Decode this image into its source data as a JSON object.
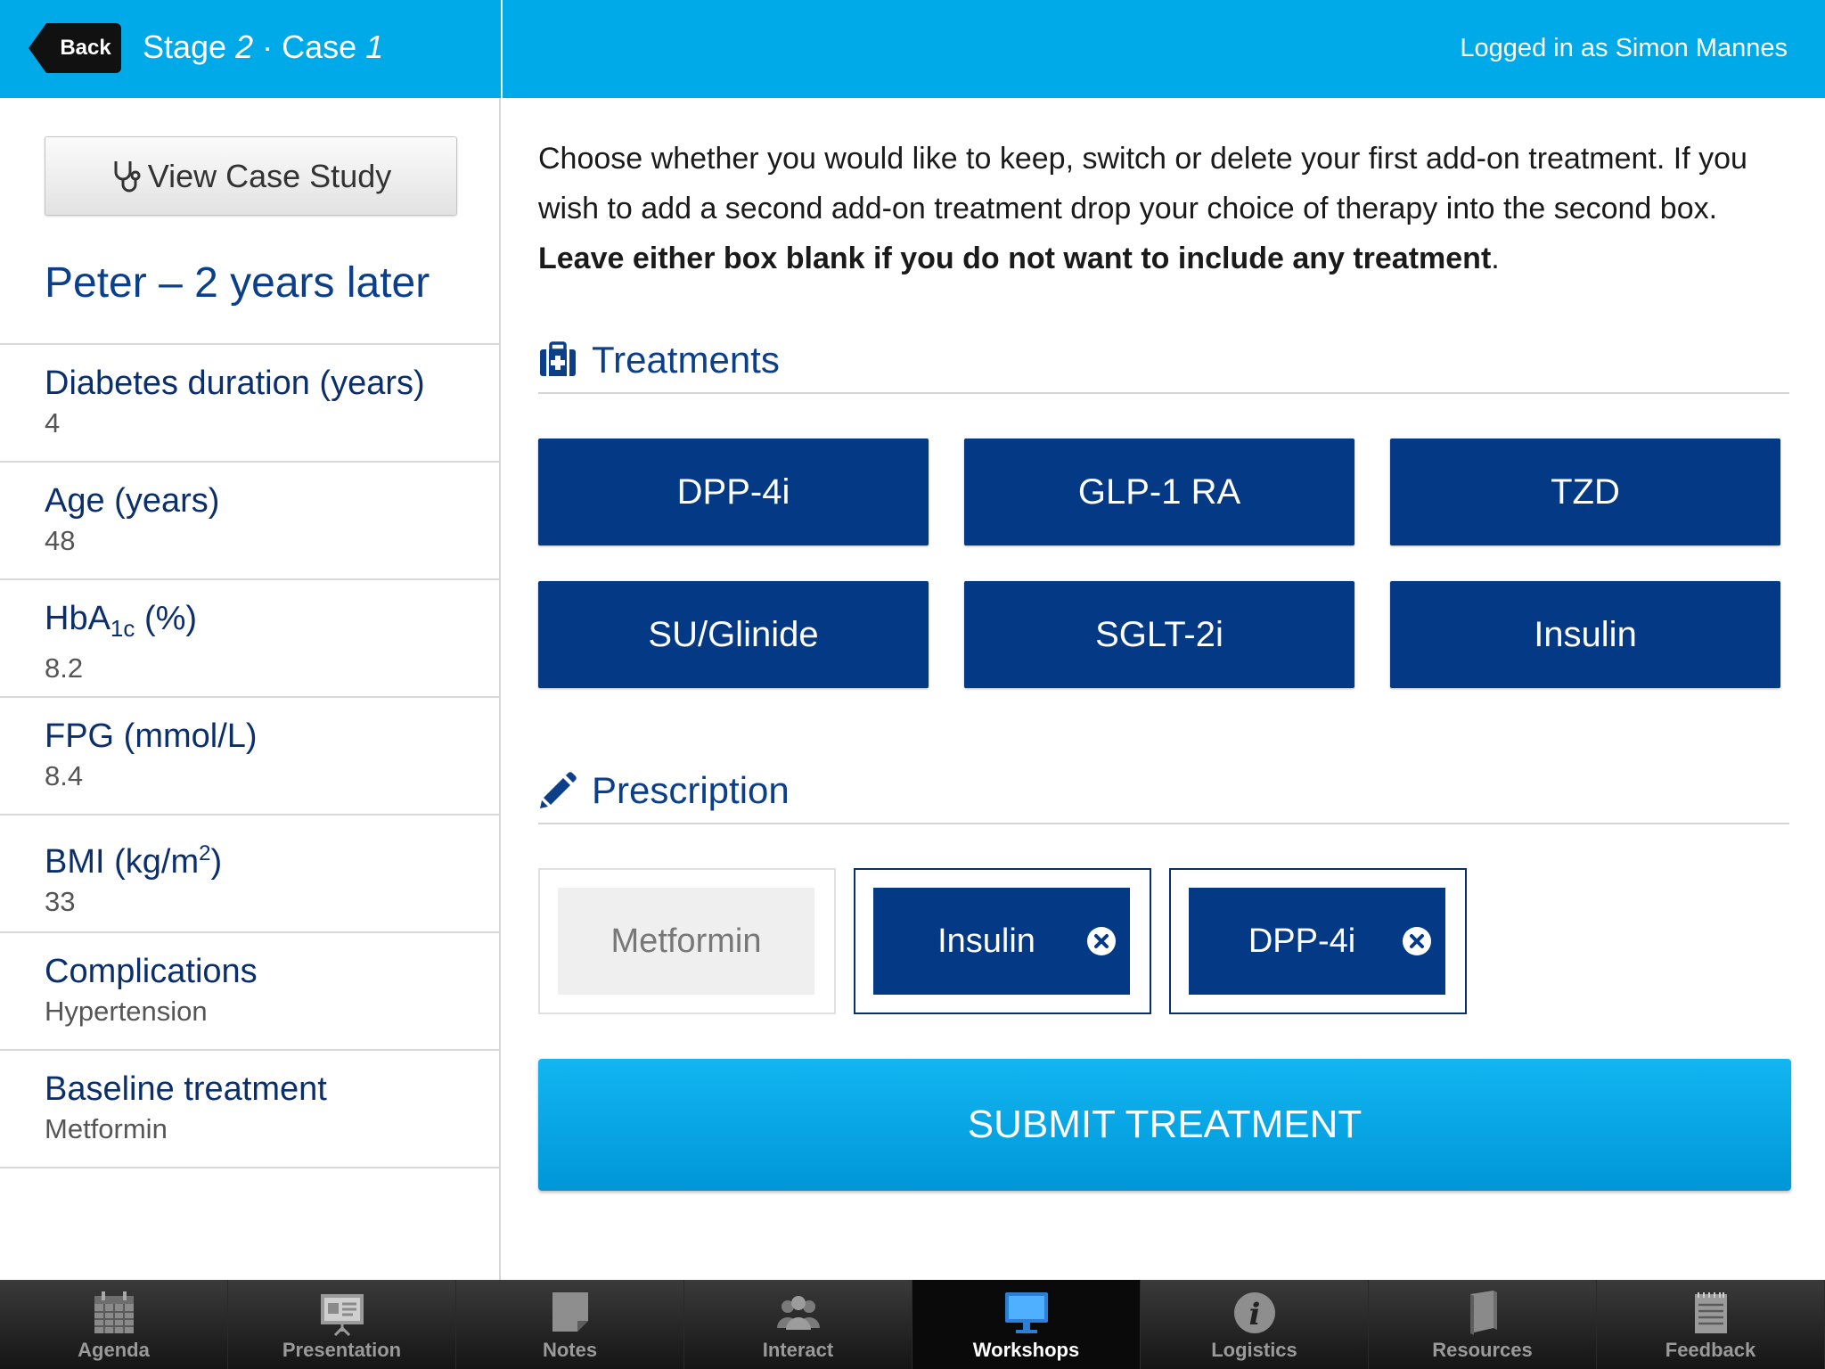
{
  "header": {
    "back_label": "Back",
    "stage_word": "Stage",
    "stage_number": "2",
    "separator": "·",
    "case_word": "Case",
    "case_number": "1",
    "logged_in": "Logged in as Simon Mannes"
  },
  "sidebar": {
    "view_case_label": "View Case Study",
    "patient_title": "Peter – 2 years later",
    "items": [
      {
        "label": "Diabetes duration (years)",
        "value": "4"
      },
      {
        "label_main": "Age (years)",
        "value": "48"
      },
      {
        "label_pre": "HbA",
        "label_sub": "1c",
        "label_post": " (%)",
        "value": "8.2"
      },
      {
        "label": "FPG (mmol/L)",
        "value": "8.4"
      },
      {
        "label_pre": "BMI (kg/m",
        "label_sup": "2",
        "label_post": ")",
        "value": "33"
      },
      {
        "label": "Complications",
        "value": "Hypertension"
      },
      {
        "label": "Baseline treatment",
        "value": "Metformin"
      }
    ]
  },
  "main": {
    "instructions_plain": "Choose whether you would like to keep, switch or delete your first add-on treatment. If you wish to add a second add-on treatment drop your choice of therapy into the second box. ",
    "instructions_bold": "Leave either box blank if you do not want to include any treatment",
    "instructions_end": ".",
    "treatments_heading": "Treatments",
    "treatments": [
      "DPP-4i",
      "GLP-1 RA",
      "TZD",
      "SU/Glinide",
      "SGLT-2i",
      "Insulin"
    ],
    "prescription_heading": "Prescription",
    "prescription": [
      {
        "label": "Metformin",
        "removable": false
      },
      {
        "label": "Insulin",
        "removable": true
      },
      {
        "label": "DPP-4i",
        "removable": true
      }
    ],
    "submit_label": "SUBMIT TREATMENT"
  },
  "tabbar": {
    "tabs": [
      {
        "label": "Agenda",
        "icon": "calendar-icon",
        "active": false
      },
      {
        "label": "Presentation",
        "icon": "presentation-icon",
        "active": false
      },
      {
        "label": "Notes",
        "icon": "notes-icon",
        "active": false
      },
      {
        "label": "Interact",
        "icon": "people-icon",
        "active": false
      },
      {
        "label": "Workshops",
        "icon": "monitor-icon",
        "active": true
      },
      {
        "label": "Logistics",
        "icon": "info-icon",
        "active": false
      },
      {
        "label": "Resources",
        "icon": "book-icon",
        "active": false
      },
      {
        "label": "Feedback",
        "icon": "feedback-icon",
        "active": false
      }
    ]
  },
  "colors": {
    "header_blue": "#00aae8",
    "navy": "#043a85",
    "submit_blue": "#0aa6e6"
  }
}
